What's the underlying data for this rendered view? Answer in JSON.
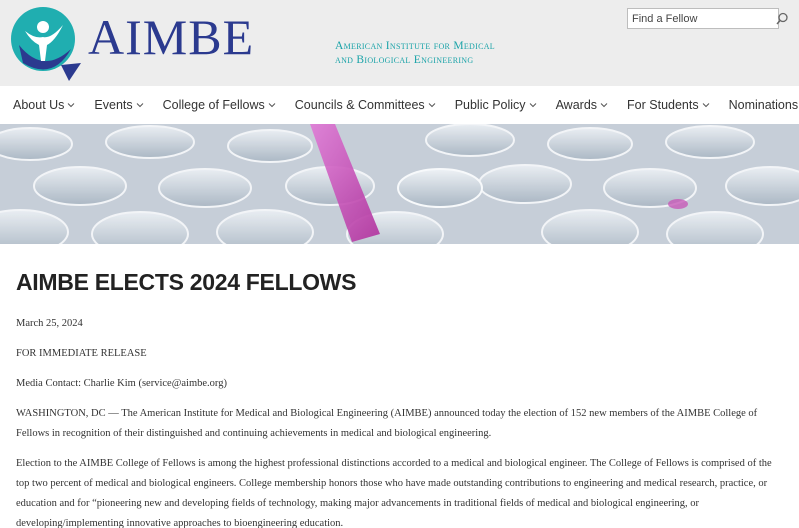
{
  "header": {
    "logo_text": "AIMBE",
    "tagline_line1": "American Institute for Medical",
    "tagline_line2": "and Biological Engineering",
    "search_placeholder": "Find a Fellow"
  },
  "nav": {
    "items": [
      {
        "label": "About Us"
      },
      {
        "label": "Events"
      },
      {
        "label": "College of Fellows"
      },
      {
        "label": "Councils & Committees"
      },
      {
        "label": "Public Policy"
      },
      {
        "label": "Awards"
      },
      {
        "label": "For Students"
      },
      {
        "label": "Nominations"
      }
    ]
  },
  "article": {
    "title": "AIMBE ELECTS 2024 FELLOWS",
    "date": "March 25, 2024",
    "release": "FOR IMMEDIATE RELEASE",
    "media_contact": "Media Contact: Charlie Kim (service@aimbe.org)",
    "para1": "WASHINGTON, DC — The American Institute for Medical and Biological Engineering (AIMBE) announced today the election of 152 new members of the AIMBE College of Fellows in recognition of their distinguished and continuing achievements in medical and biological engineering.",
    "para2": "Election to the AIMBE College of Fellows is among the highest professional distinctions accorded to a medical and biological engineer. The College of Fellows is comprised of the top two percent of medical and biological engineers. College membership honors those who have made outstanding contributions to engineering and medical research, practice, or education and for “pioneering new and developing fields of technology, making major advancements in traditional fields of medical and biological engineering, or developing/implementing innovative approaches to bioengineering education."
  },
  "colors": {
    "brand_blue": "#2b3a8f",
    "brand_teal": "#1aa3a8",
    "header_bg": "#ededed"
  },
  "icons": [
    "aimbe-logo-icon",
    "search-icon",
    "chevron-down-icon"
  ]
}
